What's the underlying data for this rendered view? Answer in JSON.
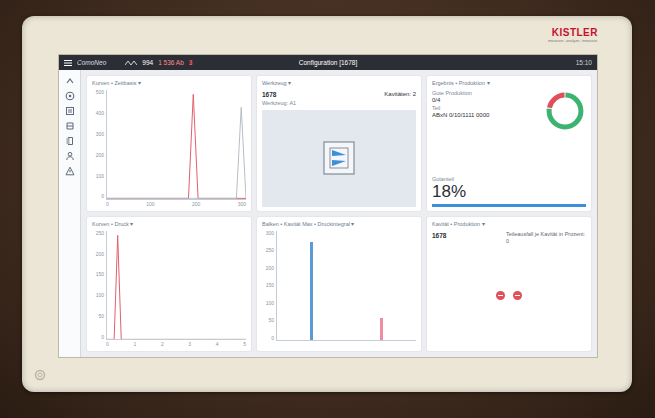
{
  "device": {
    "brand": "KISTLER",
    "tagline": "measure. analyze. innovate."
  },
  "topbar": {
    "app": "ComoNeo",
    "count": "994",
    "detail": "1 536 Ab",
    "alarm": "3",
    "configuration": "Configuration [1678]",
    "time": "15:10"
  },
  "cards": [
    {
      "kind": "line",
      "title": "Kurven • Zeitbasis ▾",
      "y_ticks": [
        "500",
        "400",
        "300",
        "200",
        "100",
        "0"
      ],
      "x_ticks": [
        "0",
        "100",
        "200",
        "300"
      ],
      "series": [
        {
          "values": [
            0,
            0,
            0,
            0,
            0,
            0,
            0,
            0,
            0,
            0,
            0,
            0,
            0,
            0,
            0,
            0,
            0,
            0,
            480,
            0,
            0,
            0,
            0,
            0,
            0,
            0,
            0,
            0,
            0,
            0
          ],
          "color": "#e0606e"
        },
        {
          "values": [
            0,
            0,
            0,
            0,
            0,
            0,
            0,
            0,
            0,
            0,
            0,
            0,
            0,
            0,
            0,
            0,
            0,
            0,
            0,
            0,
            0,
            0,
            0,
            0,
            0,
            0,
            0,
            0,
            420,
            0
          ],
          "color": "#b8bec6"
        }
      ]
    },
    {
      "kind": "tool",
      "title": "Werkzeug ▾",
      "id_text": "1678",
      "cavities": "Kavitäten: 2",
      "subtitle": "Werkzeug: A1"
    },
    {
      "kind": "production",
      "title": "Ergebnis • Produktion ▾",
      "rows": [
        {
          "label": "Gute Produktion",
          "value": "0/4"
        },
        {
          "label": "Teil",
          "value": "ABxN 0/10/1111 0000"
        }
      ],
      "share_label": "Gutanteil",
      "share": "18%",
      "progress": {
        "level": 1
      },
      "donut": [
        {
          "level": 0.78,
          "color": "#3cb371"
        },
        {
          "level": 0.22,
          "color": "#e0505a"
        }
      ]
    },
    {
      "kind": "line",
      "title": "Kurven • Druck ▾",
      "y_ticks": [
        "250",
        "200",
        "150",
        "100",
        "50",
        "0"
      ],
      "x_ticks": [
        "0",
        "1",
        "2",
        "3",
        "4",
        "5"
      ],
      "series": [
        {
          "values": [
            0,
            0,
            0,
            240,
            0,
            0,
            0,
            0,
            0,
            0,
            0,
            0,
            0,
            0,
            0,
            0,
            0,
            0,
            0,
            0,
            0,
            0,
            0,
            0,
            0,
            0,
            0,
            0,
            0,
            0,
            0,
            0,
            0,
            0,
            0,
            0,
            0,
            0,
            0,
            0
          ],
          "color": "#e0606e"
        }
      ]
    },
    {
      "kind": "bar",
      "title": "Balken • Kavität Max • Druckintegral ▾",
      "y_ticks": [
        "300",
        "250",
        "200",
        "150",
        "100",
        "50",
        "0"
      ],
      "bars": [
        {
          "value": 270,
          "color": "#5b9bd5"
        },
        {
          "value": 60,
          "color": "#f08ca0"
        }
      ]
    },
    {
      "kind": "cavity",
      "title": "Kavität • Produktion ▾",
      "id_text": "1678",
      "note": "Teileausfall je Kavität in Prozent: 0",
      "cavities": [
        {
          "color": "#e0505a"
        },
        {
          "color": "#e0505a"
        }
      ]
    }
  ]
}
